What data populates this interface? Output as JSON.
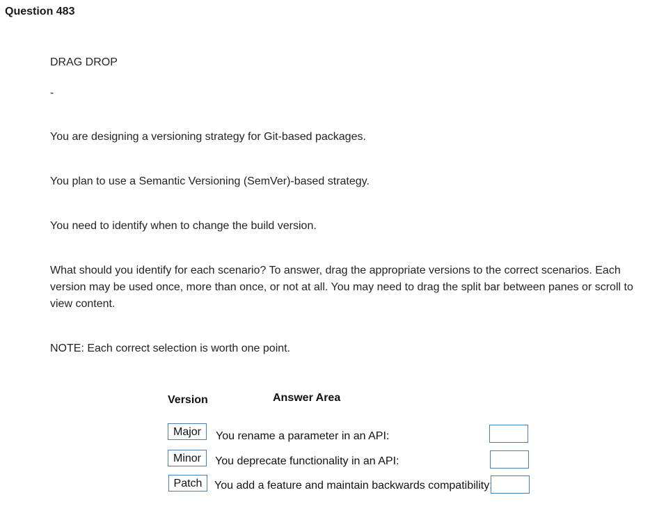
{
  "question": {
    "title": "Question 483",
    "type_label": "DRAG DROP",
    "separator": "-",
    "paragraphs": [
      "You are designing a versioning strategy for Git-based packages.",
      "You plan to use a Semantic Versioning (SemVer)-based strategy.",
      "You need to identify when to change the build version.",
      "What should you identify for each scenario? To answer, drag the appropriate versions to the correct scenarios. Each version may be used once, more than once, or not at all. You may need to drag the split bar between panes or scroll to view content.",
      "NOTE: Each correct selection is worth one point."
    ]
  },
  "exhibit": {
    "version_header": "Version",
    "answer_header": "Answer Area",
    "versions": [
      "Major",
      "Minor",
      "Patch"
    ],
    "scenarios": [
      "You rename a parameter in an API:",
      "You deprecate functionality in an API:",
      "You add a feature and maintain backwards compatibility:"
    ],
    "accent_color": "#4a7fb5"
  }
}
